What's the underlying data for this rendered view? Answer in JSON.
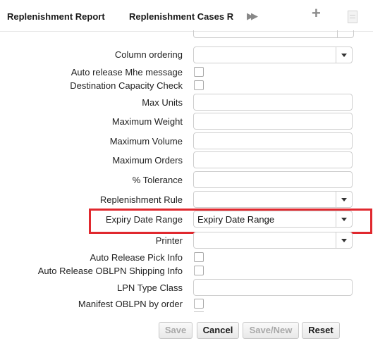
{
  "tabs": {
    "tab1": "Replenishment Report",
    "tab2": "Replenishment Cases R"
  },
  "toolbar": {
    "overflow_icon": "fast-forward-icon",
    "add_icon": "plus-icon",
    "doc_icon": "document-icon"
  },
  "form": {
    "column_ordering": {
      "label": "Column ordering",
      "value": ""
    },
    "auto_release_mhe": {
      "label": "Auto release Mhe message",
      "checked": false
    },
    "dest_capacity_check": {
      "label": "Destination Capacity Check",
      "checked": false
    },
    "max_units": {
      "label": "Max Units",
      "value": ""
    },
    "max_weight": {
      "label": "Maximum Weight",
      "value": ""
    },
    "max_volume": {
      "label": "Maximum Volume",
      "value": ""
    },
    "max_orders": {
      "label": "Maximum Orders",
      "value": ""
    },
    "tolerance": {
      "label": "% Tolerance",
      "value": ""
    },
    "replenishment_rule": {
      "label": "Replenishment Rule",
      "value": ""
    },
    "expiry_date_range": {
      "label": "Expiry Date Range",
      "value": "Expiry Date Range"
    },
    "printer": {
      "label": "Printer",
      "value": ""
    },
    "auto_release_pick": {
      "label": "Auto Release Pick Info",
      "checked": false
    },
    "auto_release_oblpn": {
      "label": "Auto Release OBLPN Shipping Info",
      "checked": false
    },
    "lpn_type_class": {
      "label": "LPN Type Class",
      "value": ""
    },
    "manifest_oblpn": {
      "label": "Manifest OBLPN by order",
      "checked": false
    }
  },
  "buttons": {
    "save": "Save",
    "cancel": "Cancel",
    "save_new": "Save/New",
    "reset": "Reset"
  },
  "colors": {
    "highlight": "#e0282e",
    "disabled_text": "#a8a8a8"
  }
}
